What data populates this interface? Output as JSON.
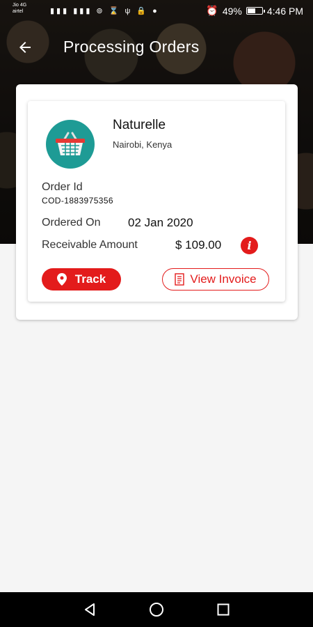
{
  "status_bar": {
    "carrier_line1": "Jio 4G",
    "carrier_line2": "airtel",
    "icons": "▮▮▮ ▮▮▮ ⊚ ⌛ ψ 🔒 ●",
    "battery_percent": "49%",
    "time": "4:46 PM"
  },
  "header": {
    "title": "Processing Orders",
    "back_icon": "arrow-left"
  },
  "order": {
    "store_name": "Naturelle",
    "store_location": "Nairobi, Kenya",
    "order_id_label": "Order Id",
    "order_id": "COD-1883975356",
    "ordered_on_label": "Ordered On",
    "ordered_on": "02 Jan 2020",
    "amount_label": "Receivable Amount",
    "amount": "$ 109.00",
    "info_glyph": "i"
  },
  "actions": {
    "track_label": "Track",
    "invoice_label": "View Invoice"
  },
  "colors": {
    "accent": "#e31b1b",
    "logo_bg": "#1e9b95"
  }
}
